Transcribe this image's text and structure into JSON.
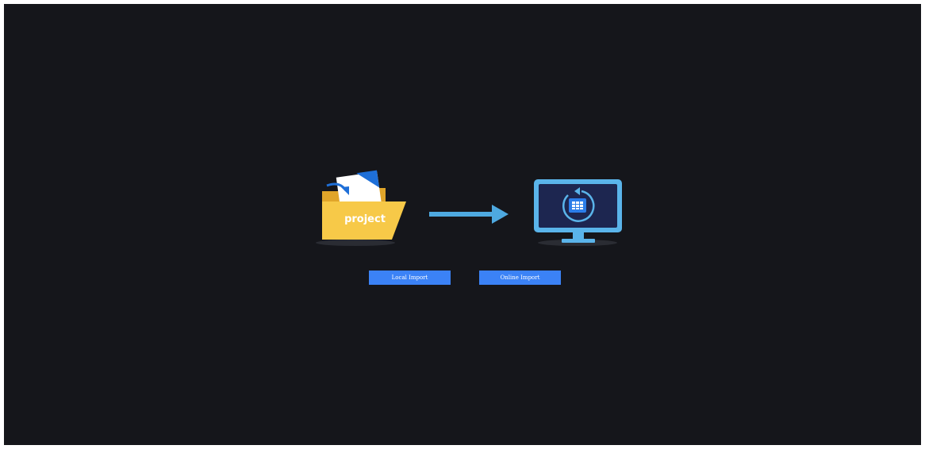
{
  "folder": {
    "label": "project",
    "icon": "folder-import-icon"
  },
  "arrow": {
    "icon": "arrow-right-icon"
  },
  "monitor": {
    "icon": "monitor-sync-icon"
  },
  "buttons": {
    "local_import": "Local Import",
    "online_import": "Online Import"
  },
  "colors": {
    "background": "#15161b",
    "button": "#3b82f6",
    "folder": "#f7c948",
    "arrow": "#4ea9e0",
    "monitor_frame": "#5ab4ea",
    "monitor_screen": "#1d2650"
  }
}
